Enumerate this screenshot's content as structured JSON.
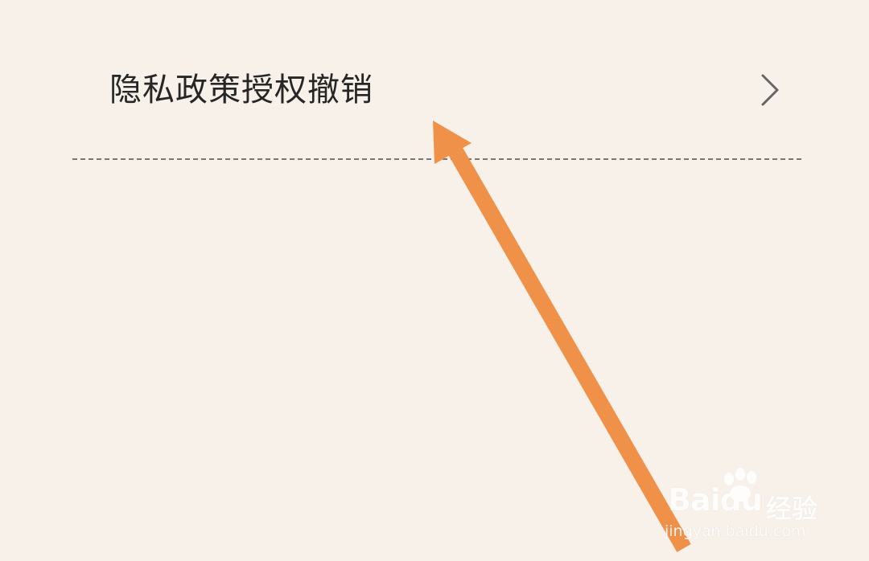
{
  "settings_item": {
    "label": "隐私政策授权撤销",
    "chevron_icon": "chevron-right-icon"
  },
  "annotation": {
    "icon": "arrow-up-left-icon",
    "color": "#f0914a"
  },
  "watermark": {
    "brand": "Baidu",
    "brand_cn": "经验",
    "url": "jingyan.baidu.com",
    "icon": "paw-icon"
  },
  "colors": {
    "background": "#f7f1e9",
    "text": "#262626",
    "divider": "#777777"
  }
}
